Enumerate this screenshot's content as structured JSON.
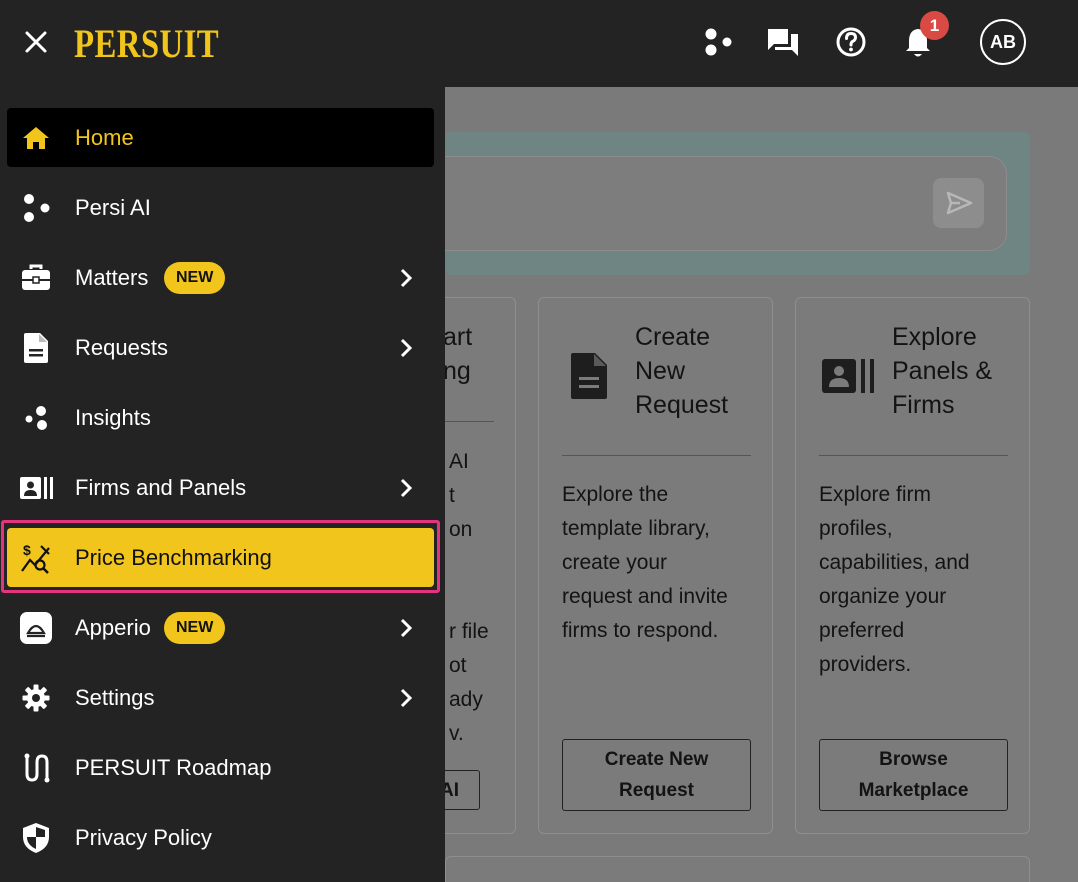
{
  "brand": {
    "logo_text": "PERSUIT",
    "accent": "#f2c51d"
  },
  "header": {
    "notification_count": "1",
    "avatar_initials": "AB"
  },
  "sidebar": {
    "items": [
      {
        "label": "Home",
        "icon": "home-icon",
        "state": "active"
      },
      {
        "label": "Persi AI",
        "icon": "persi-ai-icon"
      },
      {
        "label": "Matters",
        "icon": "briefcase-icon",
        "badge": "NEW",
        "has_submenu": true
      },
      {
        "label": "Requests",
        "icon": "document-icon",
        "has_submenu": true
      },
      {
        "label": "Insights",
        "icon": "insights-icon"
      },
      {
        "label": "Firms and Panels",
        "icon": "firms-icon",
        "has_submenu": true
      },
      {
        "label": "Price Benchmarking",
        "icon": "price-benchmark-icon",
        "state": "selected"
      },
      {
        "label": "Apperio",
        "icon": "apperio-icon",
        "badge": "NEW",
        "has_submenu": true
      },
      {
        "label": "Settings",
        "icon": "gear-icon",
        "has_submenu": true
      },
      {
        "label": "PERSUIT Roadmap",
        "icon": "roadmap-icon"
      },
      {
        "label": "Privacy Policy",
        "icon": "shield-icon"
      }
    ]
  },
  "cards": [
    {
      "title_lines": [
        "art",
        "ng"
      ],
      "desc_lines": [
        "AI",
        "t",
        "on",
        "",
        "",
        "r file",
        "ot",
        "ady",
        "v."
      ],
      "button_lines": [
        "AI"
      ]
    },
    {
      "title_lines": [
        "Create",
        "New",
        "Request"
      ],
      "desc_lines": [
        "Explore the",
        "template library,",
        "create your",
        "request and invite",
        "firms to respond."
      ],
      "button_lines": [
        "Create New",
        "Request"
      ]
    },
    {
      "title_lines": [
        "Explore",
        "Panels &",
        "Firms"
      ],
      "desc_lines": [
        "Explore firm",
        "profiles,",
        "capabilities, and",
        "organize your",
        "preferred",
        "providers."
      ],
      "button_lines": [
        "Browse",
        "Marketplace"
      ]
    }
  ]
}
